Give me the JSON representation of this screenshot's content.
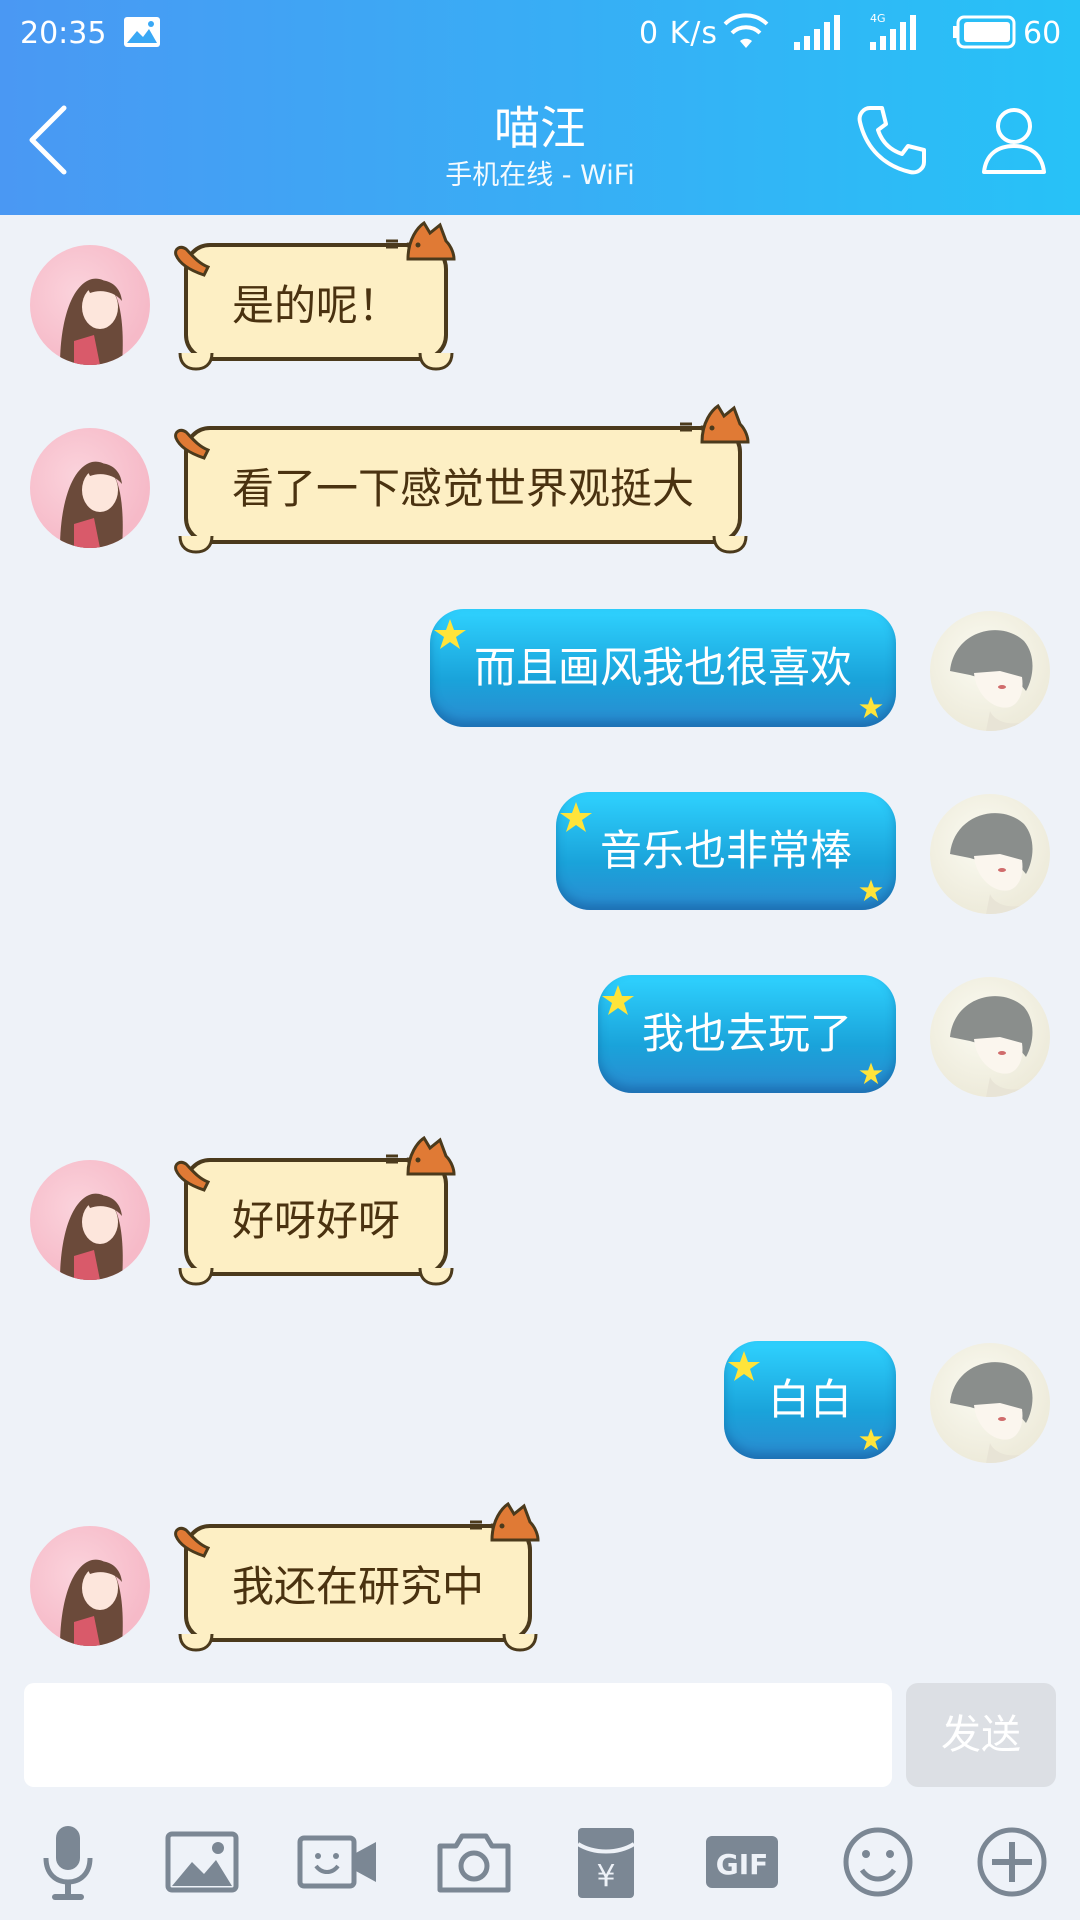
{
  "status_bar": {
    "time": "20:35",
    "net_speed": "0 K/s",
    "battery": "60"
  },
  "header": {
    "contact_name": "喵汪",
    "contact_status": "手机在线 - WiFi"
  },
  "messages": [
    {
      "side": "left",
      "text": "是的呢！"
    },
    {
      "side": "left",
      "text": "看了一下感觉世界观挺大"
    },
    {
      "side": "right",
      "text": "而且画风我也很喜欢"
    },
    {
      "side": "right",
      "text": "音乐也非常棒"
    },
    {
      "side": "right",
      "text": "我也去玩了"
    },
    {
      "side": "left",
      "text": "好呀好呀"
    },
    {
      "side": "right",
      "text": "白白"
    },
    {
      "side": "left",
      "text": "我还在研究中"
    }
  ],
  "input": {
    "value": "",
    "send_label": "发送"
  },
  "toolbar_icons": [
    "microphone-icon",
    "image-icon",
    "video-icon",
    "camera-icon",
    "red-packet-icon",
    "gif-icon",
    "emoji-icon",
    "plus-icon"
  ],
  "toolbar_gif_label": "GIF",
  "colors": {
    "header_start": "#4a98f3",
    "header_end": "#27c2f7",
    "chat_background": "#eef2f8",
    "left_bubble": "#fdefc4",
    "right_bubble": "#1aa3da"
  }
}
